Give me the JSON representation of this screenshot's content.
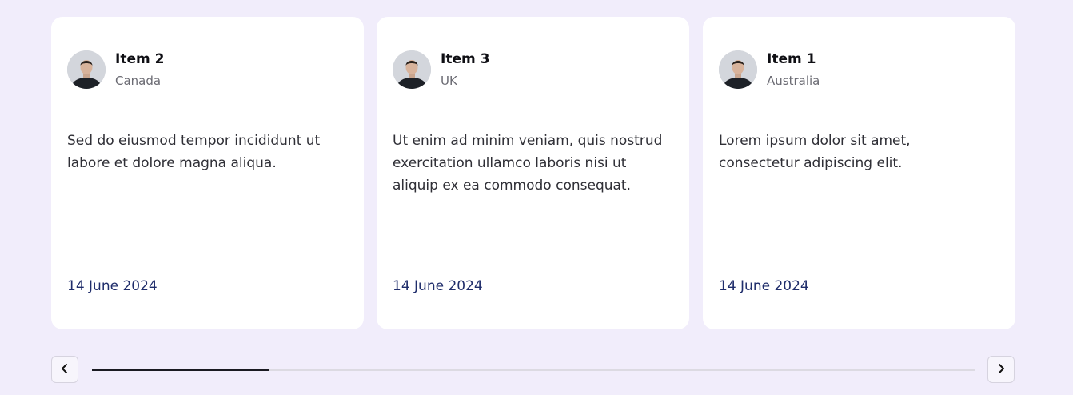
{
  "cards": [
    {
      "name": "Item 2",
      "country": "Canada",
      "text": "Sed do eiusmod tempor incididunt ut labore et dolore magna aliqua.",
      "date": "14 June 2024"
    },
    {
      "name": "Item 3",
      "country": "UK",
      "text": "Ut enim ad minim veniam, quis nostrud exercitation ullamco laboris nisi ut aliquip ex ea commodo consequat.",
      "date": "14 June 2024"
    },
    {
      "name": "Item 1",
      "country": "Australia",
      "text": "Lorem ipsum dolor sit amet, consectetur adipiscing elit.",
      "date": "14 June 2024"
    }
  ],
  "carousel": {
    "prev_icon": "chevron-left-icon",
    "next_icon": "chevron-right-icon",
    "progress_fraction": 0.2
  },
  "colors": {
    "background": "#f1edfb",
    "card": "#ffffff",
    "date": "#1f2d6b",
    "progress": "#1a1a22"
  }
}
